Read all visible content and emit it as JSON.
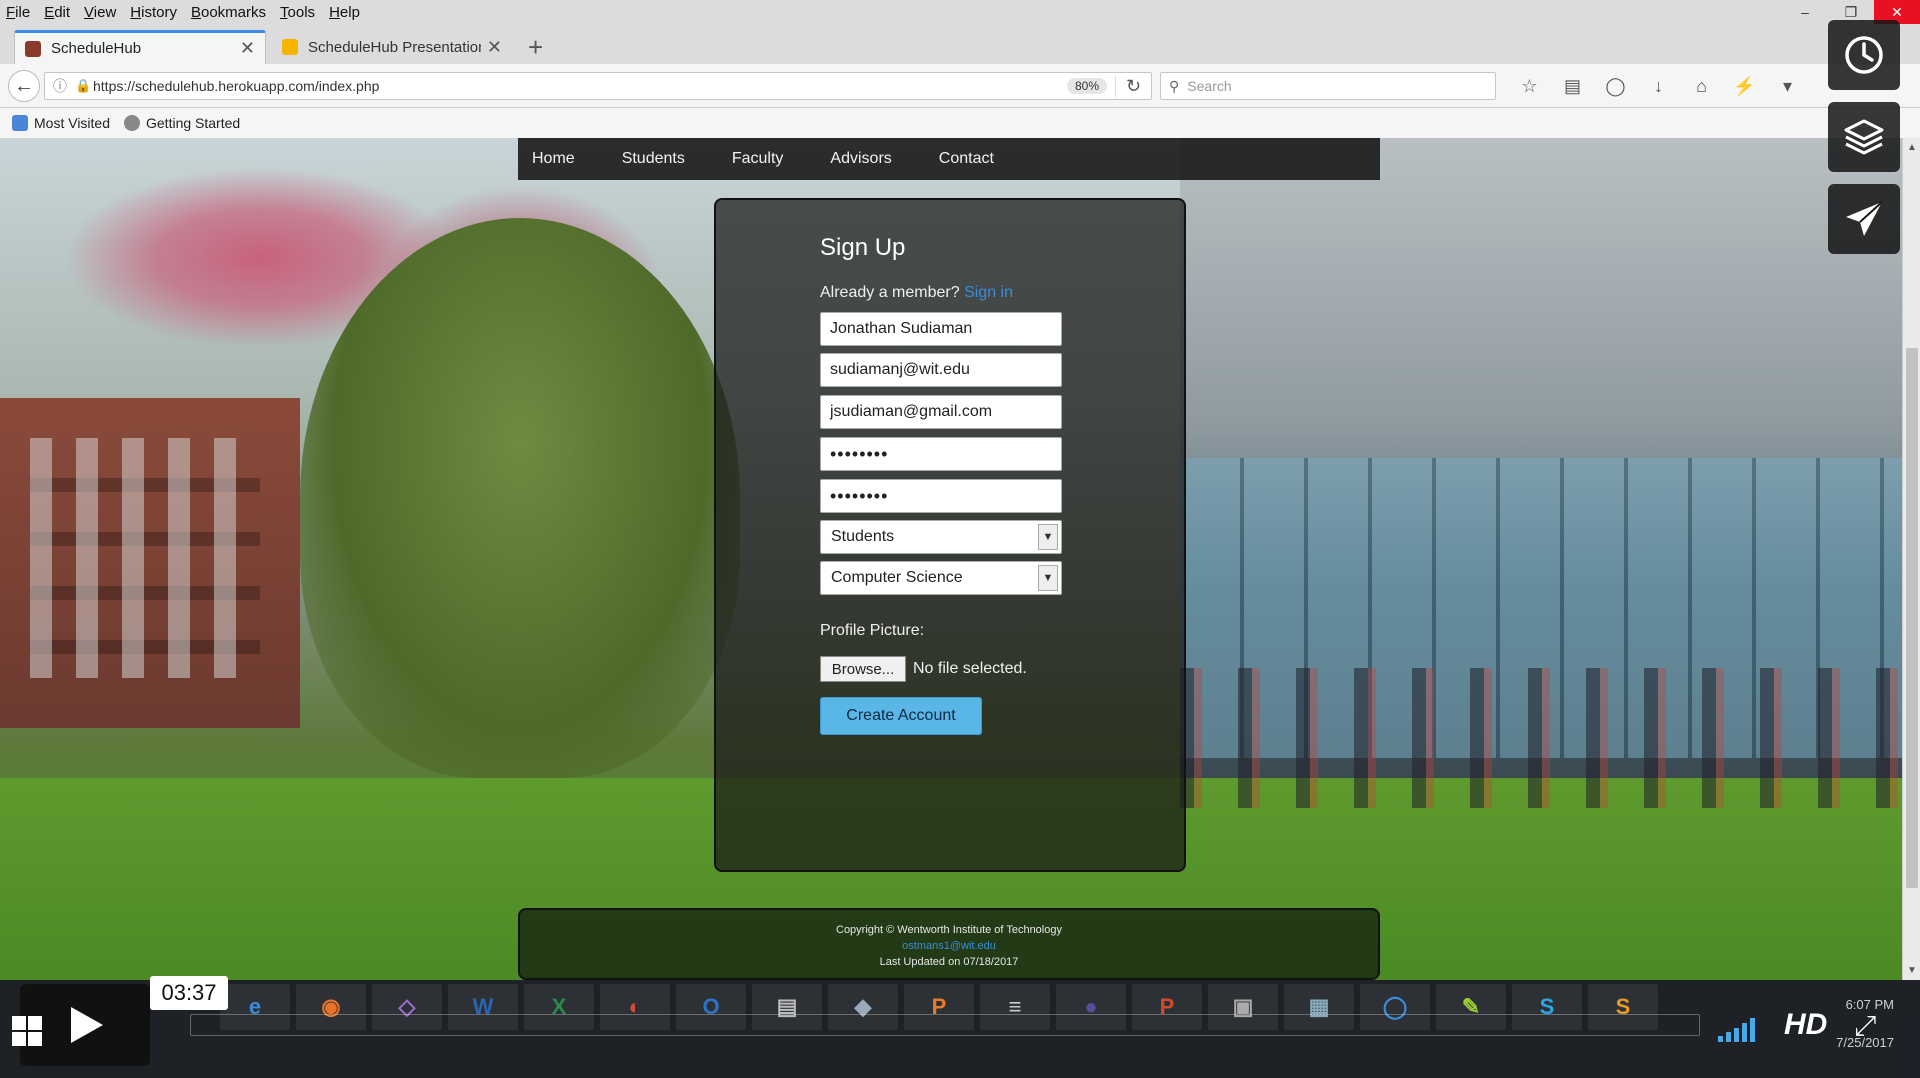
{
  "menubar": {
    "items": [
      "File",
      "Edit",
      "View",
      "History",
      "Bookmarks",
      "Tools",
      "Help"
    ]
  },
  "tabs": [
    {
      "label": "ScheduleHub",
      "active": true
    },
    {
      "label": "ScheduleHub Presentation -",
      "active": false
    }
  ],
  "navbar": {
    "url": "https://schedulehub.herokuapp.com/index.php",
    "zoom": "80%",
    "search_placeholder": "Search"
  },
  "bookmarks": [
    "Most Visited",
    "Getting Started"
  ],
  "site_nav": {
    "links": [
      "Home",
      "Students",
      "Faculty",
      "Advisors",
      "Contact"
    ]
  },
  "signup": {
    "title": "Sign Up",
    "already_member": "Already a member?",
    "sign_in_link": "Sign in",
    "fields": {
      "name": "Jonathan Sudiaman",
      "school_email": "sudiamanj@wit.edu",
      "personal_email": "jsudiaman@gmail.com",
      "password": "••••••••",
      "confirm_password": "••••••••"
    },
    "role_select": "Students",
    "major_select": "Computer Science",
    "profile_picture_label": "Profile Picture:",
    "browse_label": "Browse...",
    "file_status": "No file selected.",
    "create_button": "Create Account"
  },
  "footer": {
    "copyright": "Copyright © Wentworth Institute of Technology",
    "email": "ostmans1@wit.edu",
    "updated": "Last Updated on 07/18/2017"
  },
  "video": {
    "time": "03:37",
    "hd_label": "HD",
    "progress": 0.0
  },
  "taskbar": {
    "clock_time": "6:07 PM",
    "clock_date": "7/25/2017",
    "app_icons": [
      "e",
      "◉",
      "◇",
      "W",
      "X",
      "◐",
      "O",
      "▤",
      "◆",
      "P",
      "≡",
      "●",
      "P",
      "▣",
      "▦",
      "◯",
      "✎",
      "S",
      "S"
    ]
  },
  "colors": {
    "accent_blue": "#3a8cd8",
    "create_button": "#5bb6e8",
    "tab_accent": "#3b8ee8"
  }
}
